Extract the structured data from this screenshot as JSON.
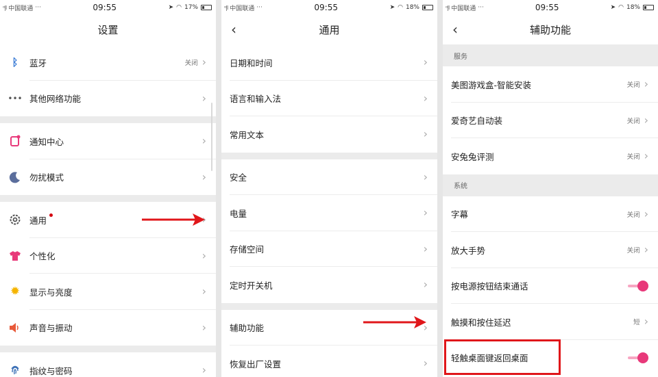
{
  "status": {
    "carrier": "中国联通",
    "time": "09:55",
    "battery_s1": "17%",
    "battery_s2": "18%",
    "battery_s3": "18%"
  },
  "screen1": {
    "title": "设置",
    "items": [
      {
        "label": "蓝牙",
        "state": "关闭",
        "icon": "bluetooth-icon"
      },
      {
        "label": "其他网络功能",
        "icon": "more-dots-icon"
      },
      {
        "label": "通知中心",
        "icon": "notification-icon"
      },
      {
        "label": "勿扰模式",
        "icon": "moon-icon"
      },
      {
        "label": "通用",
        "icon": "gear-icon"
      },
      {
        "label": "个性化",
        "icon": "tshirt-icon"
      },
      {
        "label": "显示与亮度",
        "icon": "sun-icon"
      },
      {
        "label": "声音与振动",
        "icon": "speaker-icon"
      },
      {
        "label": "指纹与密码",
        "icon": "fingerprint-icon"
      }
    ]
  },
  "screen2": {
    "title": "通用",
    "items": [
      {
        "label": "日期和时间"
      },
      {
        "label": "语言和输入法"
      },
      {
        "label": "常用文本"
      },
      {
        "label": "安全"
      },
      {
        "label": "电量"
      },
      {
        "label": "存储空间"
      },
      {
        "label": "定时开关机"
      },
      {
        "label": "辅助功能"
      },
      {
        "label": "恢复出厂设置"
      }
    ]
  },
  "screen3": {
    "title": "辅助功能",
    "section_services": "服务",
    "section_system": "系统",
    "services": [
      {
        "label": "美图游戏盒-智能安装",
        "state": "关闭"
      },
      {
        "label": "爱奇艺自动装",
        "state": "关闭"
      },
      {
        "label": "安兔兔评测",
        "state": "关闭"
      }
    ],
    "system": [
      {
        "label": "字幕",
        "state": "关闭"
      },
      {
        "label": "放大手势",
        "state": "关闭"
      },
      {
        "label": "按电源按钮结束通话",
        "toggle": true
      },
      {
        "label": "触摸和按住延迟",
        "state": "短"
      },
      {
        "label": "轻触桌面键返回桌面",
        "toggle": true
      }
    ]
  },
  "colors": {
    "accent_pink": "#e8397a",
    "annotation_red": "#e0161a"
  }
}
